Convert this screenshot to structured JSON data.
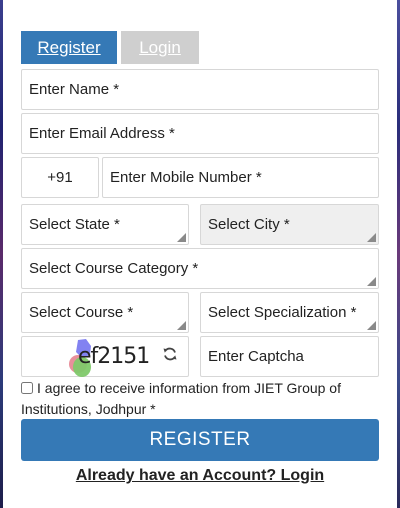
{
  "tabs": {
    "register": "Register",
    "login": "Login"
  },
  "form": {
    "name_placeholder": "Enter Name *",
    "email_placeholder": "Enter Email Address *",
    "country_code": "+91",
    "mobile_placeholder": "Enter Mobile Number *",
    "state_placeholder": "Select State *",
    "city_placeholder": "Select City *",
    "course_category_placeholder": "Select Course Category *",
    "course_placeholder": "Select Course *",
    "specialization_placeholder": "Select Specialization *",
    "captcha_text": "ef2151",
    "captcha_placeholder": "Enter Captcha",
    "agree_text": "I agree to receive information from JIET Group of Institutions, Jodhpur *",
    "register_button": "REGISTER",
    "login_link": "Already have an Account? Login"
  },
  "colors": {
    "primary": "#3579b6",
    "inactive_tab": "#cfcfcf",
    "disabled_field": "#efefef"
  },
  "icons": {
    "refresh": "refresh-icon",
    "select_arrow": "select-arrow-icon"
  }
}
